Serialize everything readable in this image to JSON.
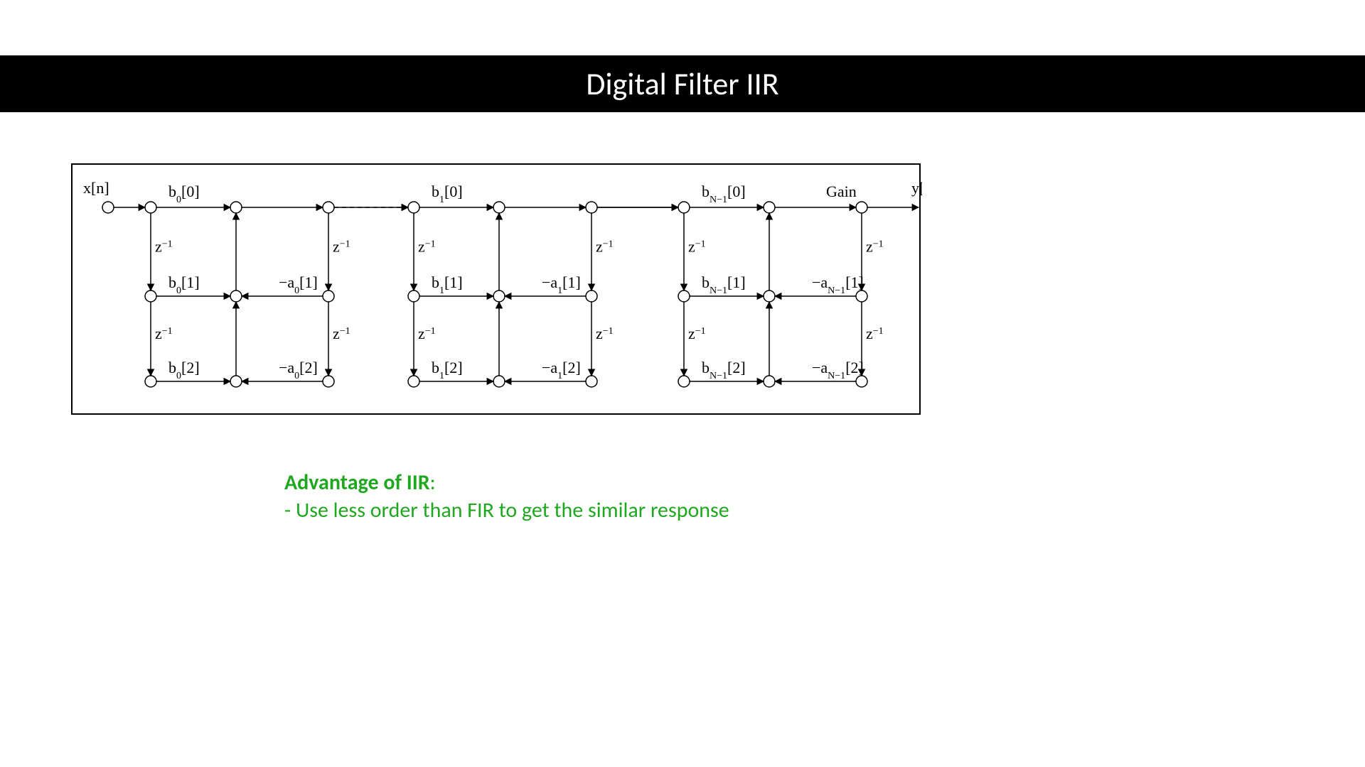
{
  "title": "Digital Filter IIR",
  "advantage": {
    "heading": "Advantage of IIR",
    "bullet": "- Use less order than FIR to get the similar response"
  },
  "diagram": {
    "input": "x[n]",
    "output": "y[n]",
    "gain": "Gain",
    "delay": "z",
    "delay_exp": "−1",
    "sections": [
      {
        "b_top": {
          "pre": "b",
          "sub": "0",
          "arg": "[0]"
        },
        "b_mid": {
          "pre": "b",
          "sub": "0",
          "arg": "[1]"
        },
        "b_bot": {
          "pre": "b",
          "sub": "0",
          "arg": "[2]"
        },
        "a_mid": {
          "pre": "−a",
          "sub": "0",
          "arg": "[1]"
        },
        "a_bot": {
          "pre": "−a",
          "sub": "0",
          "arg": "[2]"
        }
      },
      {
        "b_top": {
          "pre": "b",
          "sub": "1",
          "arg": "[0]"
        },
        "b_mid": {
          "pre": "b",
          "sub": "1",
          "arg": "[1]"
        },
        "b_bot": {
          "pre": "b",
          "sub": "1",
          "arg": "[2]"
        },
        "a_mid": {
          "pre": "−a",
          "sub": "1",
          "arg": "[1]"
        },
        "a_bot": {
          "pre": "−a",
          "sub": "1",
          "arg": "[2]"
        }
      },
      {
        "b_top": {
          "pre": "b",
          "sub": "N−1",
          "arg": "[0]"
        },
        "b_mid": {
          "pre": "b",
          "sub": "N−1",
          "arg": "[1]"
        },
        "b_bot": {
          "pre": "b",
          "sub": "N−1",
          "arg": "[2]"
        },
        "a_mid": {
          "pre": "−a",
          "sub": "N−1",
          "arg": "[1]"
        },
        "a_bot": {
          "pre": "−a",
          "sub": "N−1",
          "arg": "[2]"
        }
      }
    ]
  }
}
